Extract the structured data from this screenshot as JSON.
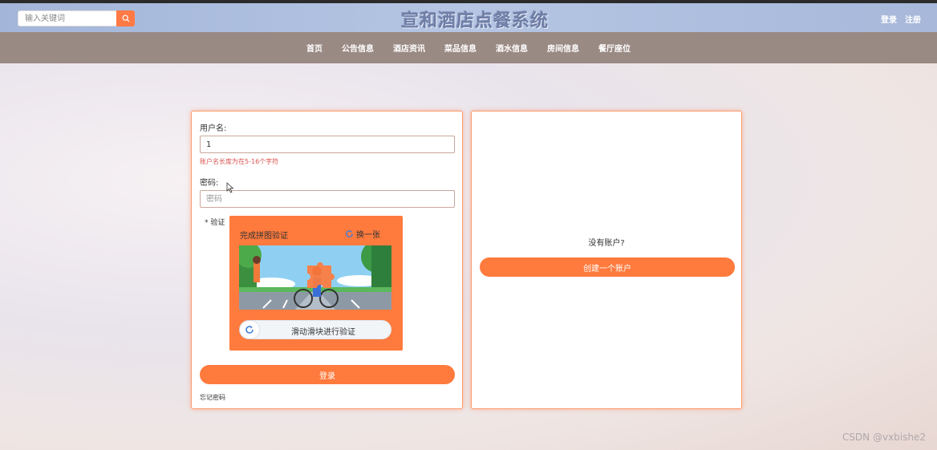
{
  "header": {
    "search_placeholder": "输入关键词",
    "site_title": "宣和酒店点餐系统",
    "login_link": "登录",
    "register_link": "注册"
  },
  "nav": {
    "items": [
      "首页",
      "公告信息",
      "酒店资讯",
      "菜品信息",
      "酒水信息",
      "房间信息",
      "餐厅座位"
    ]
  },
  "login_form": {
    "username_label": "用户名:",
    "username_value": "1",
    "username_error": "账户名长度为在5-16个字符",
    "password_label": "密码:",
    "password_placeholder": "密码",
    "verify_label": "* 验证",
    "captcha": {
      "title": "完成拼图验证",
      "refresh_label": "换一张",
      "slider_text": "滑动滑块进行验证"
    },
    "submit_label": "登录",
    "forgot_label": "忘记密码"
  },
  "register_panel": {
    "prompt": "没有账户?",
    "create_label": "创建一个账户"
  },
  "watermark": "CSDN @vxbishe2",
  "colors": {
    "accent": "#ff7a3d",
    "header_bg": "#a3b6d9",
    "nav_bg": "#9a8a84"
  }
}
